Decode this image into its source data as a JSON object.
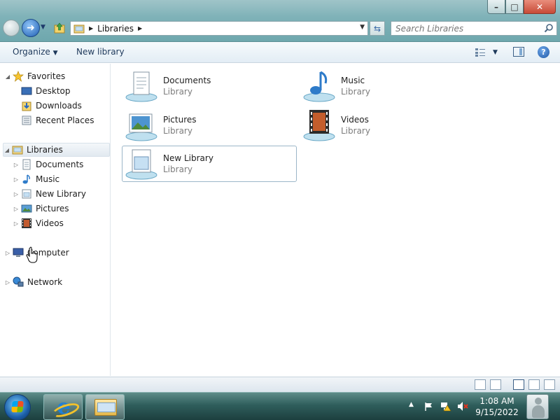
{
  "window": {
    "buttons": {
      "minimize": "–",
      "maximize": "□",
      "close": "✕"
    }
  },
  "address": {
    "segments": [
      "Libraries"
    ],
    "search_placeholder": "Search Libraries"
  },
  "toolbar": {
    "organize_label": "Organize",
    "new_library_label": "New library"
  },
  "nav": {
    "favorites": {
      "label": "Favorites",
      "items": [
        "Desktop",
        "Downloads",
        "Recent Places"
      ]
    },
    "libraries": {
      "label": "Libraries",
      "items": [
        "Documents",
        "Music",
        "New Library",
        "Pictures",
        "Videos"
      ]
    },
    "computer": {
      "label": "Computer"
    },
    "network": {
      "label": "Network"
    }
  },
  "content": {
    "libraries": [
      {
        "name": "Documents",
        "type": "Library",
        "icon": "documents-library-icon"
      },
      {
        "name": "Music",
        "type": "Library",
        "icon": "music-library-icon"
      },
      {
        "name": "Pictures",
        "type": "Library",
        "icon": "pictures-library-icon"
      },
      {
        "name": "Videos",
        "type": "Library",
        "icon": "videos-library-icon"
      },
      {
        "name": "New Library",
        "type": "Library",
        "icon": "new-library-icon"
      }
    ]
  },
  "taskbar": {
    "time": "1:08 AM",
    "date": "9/15/2022"
  },
  "colors": {
    "toolbar_text": "#1e395b",
    "secondary_text": "#7d7d7d",
    "taskbar": "#2f5e5c"
  }
}
